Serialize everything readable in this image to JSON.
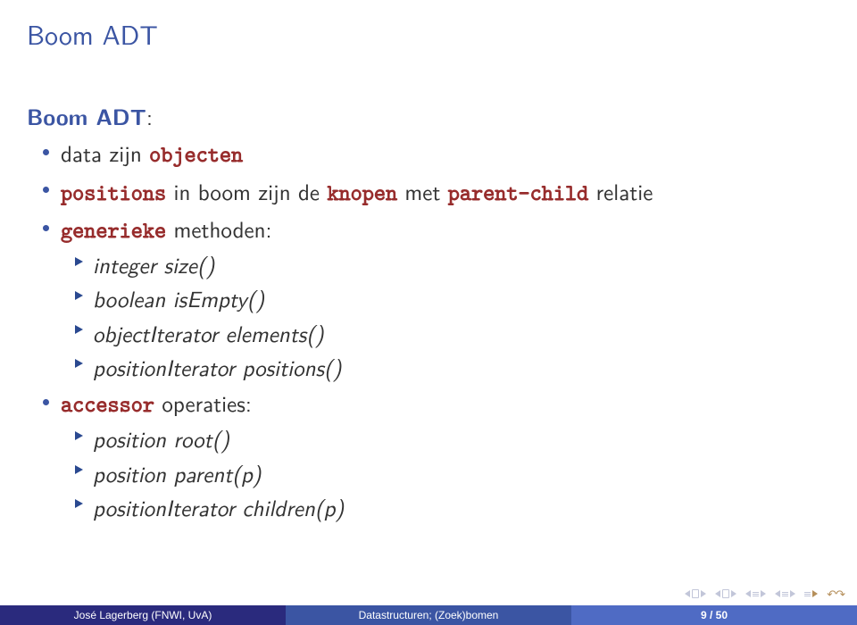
{
  "title": "Boom ADT",
  "heading": "Boom ADT",
  "b1": {
    "pre": "data zijn ",
    "kw": "objecten"
  },
  "b2": {
    "kw1": "positions",
    "mid": " in boom zijn de ",
    "kw2": "knopen",
    "mid2": " met ",
    "kw3": "parent-child",
    "post": " relatie"
  },
  "b3": {
    "kw": "generieke",
    "post": " methoden:",
    "m1": "integer size()",
    "m2": "boolean isEmpty()",
    "m3": "objectIterator elements()",
    "m4": "positionIterator positions()"
  },
  "b4": {
    "kw": "accessor",
    "post": " operaties:",
    "m1": "position root()",
    "m2": "position parent(p)",
    "m3": "positionIterator children(p)"
  },
  "footer": {
    "author": "José Lagerberg  (FNWI, UvA)",
    "topic": "Datastructuren; (Zoek)bomen",
    "page": "9 / 50"
  }
}
